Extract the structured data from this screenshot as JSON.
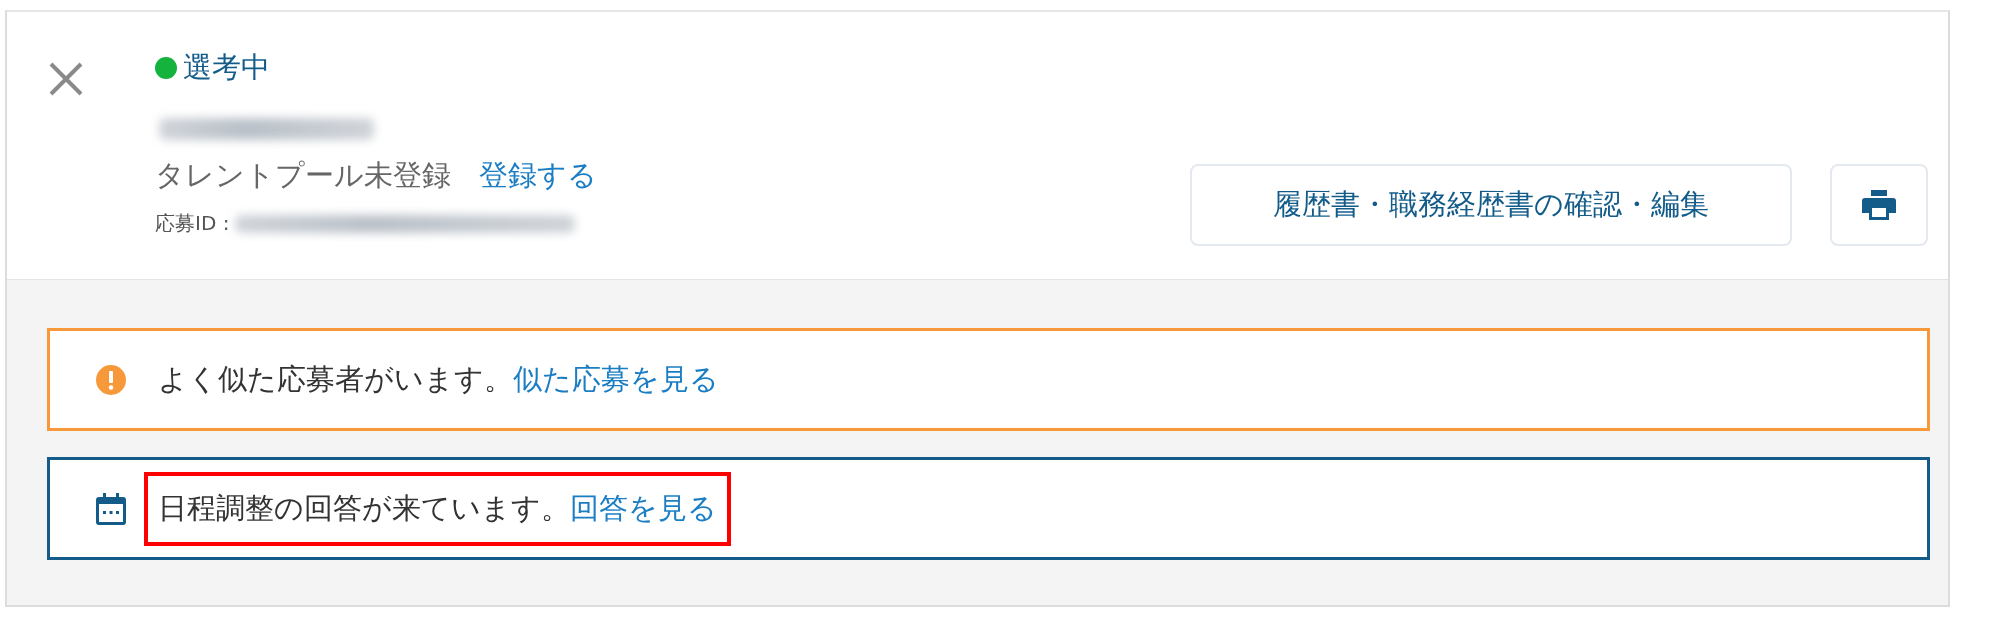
{
  "status": {
    "label": "選考中",
    "color": "#13b33d"
  },
  "applicant": {
    "email_redacted": true,
    "talent_pool": "タレントプール未登録",
    "register_link": "登録する",
    "id_label": "応募ID :",
    "id_redacted": true
  },
  "buttons": [
    {
      "kind": "text",
      "label": "履歴書・職務経歴書の確認・編集"
    },
    {
      "kind": "print"
    }
  ],
  "banners": [
    {
      "kind": "warning",
      "message": "よく似た応募者がいます。",
      "link": "似た応募を見る",
      "highlighted": false
    },
    {
      "kind": "schedule",
      "message": "日程調整の回答が来ています。",
      "link": "回答を見る",
      "highlighted": true
    }
  ]
}
